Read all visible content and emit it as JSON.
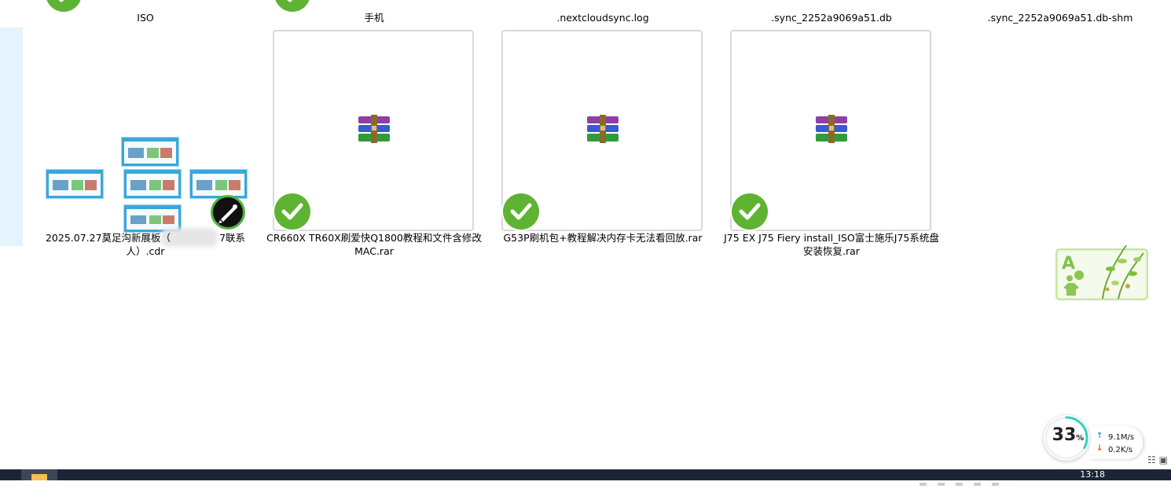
{
  "top_row": [
    {
      "label": "ISO"
    },
    {
      "label": "手机"
    },
    {
      "label": ".nextcloudsync.log"
    },
    {
      "label": ".sync_2252a9069a51.db"
    },
    {
      "label": ".sync_2252a9069a51.db-shm"
    }
  ],
  "items": [
    {
      "label_line1": "2025.07.27莫足沟新展板（",
      "label_line1_tail": "7联系",
      "label_line2": "人）.cdr"
    },
    {
      "label_line1": "CR660X TR60X刷爱快Q1800教程和文件含修改",
      "label_line2": "MAC.rar"
    },
    {
      "label_line1": "G53P刷机包+教程解决内存卡无法看回放.rar",
      "label_line2": ""
    },
    {
      "label_line1": "J75 EX J75 Fiery install_ISO富士施乐J75系统盘",
      "label_line2": "安装恢复.rar"
    }
  ],
  "network": {
    "percent": "33",
    "percent_unit": "%",
    "upload": "9.1M/s",
    "download": "0.2K/s",
    "progress_fraction": 0.33
  },
  "taskbar": {
    "time": "13:18"
  },
  "colors": {
    "check": "#5fb332",
    "accent": "#3aa7d9",
    "ring": "#2fd1c0",
    "sidebar": "#e5f3fd"
  },
  "icons": [
    "checkmark-icon",
    "winrar-archive-icon",
    "coreldraw-icon",
    "folder-icon",
    "upload-arrow-icon",
    "download-arrow-icon"
  ]
}
